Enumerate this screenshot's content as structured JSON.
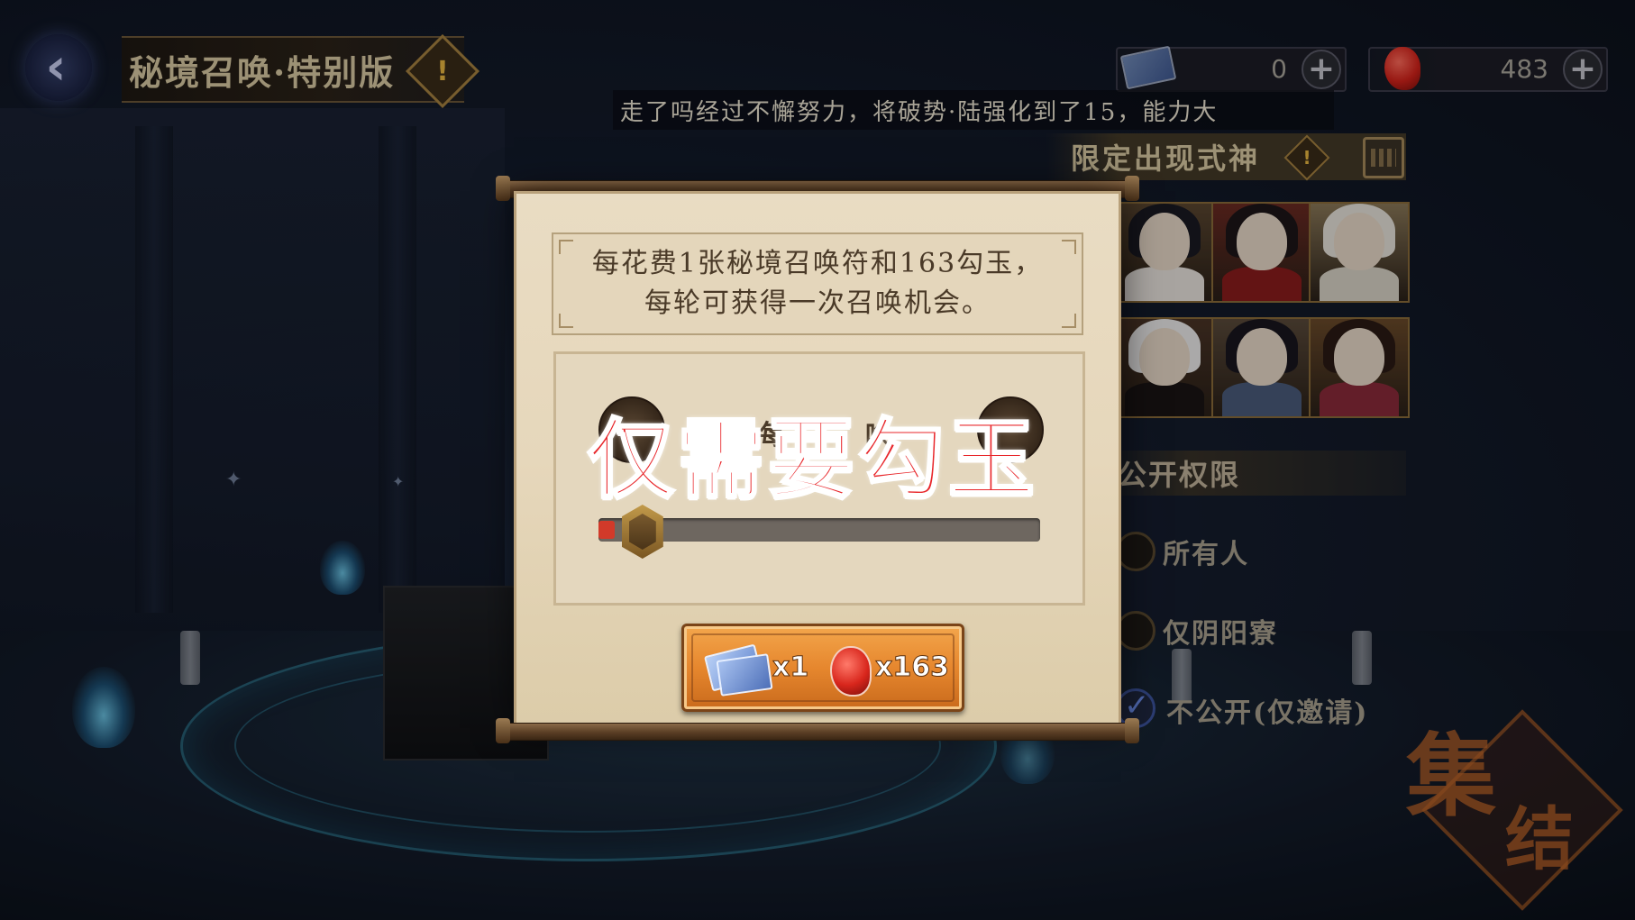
{
  "header": {
    "title": "秘境召唤·特别版",
    "info_icon": "exclamation-icon",
    "back_icon": "chevron-left-icon"
  },
  "resources": {
    "tickets": {
      "icon": "summon-ticket-icon",
      "value": "0",
      "plus": "+"
    },
    "magatama": {
      "icon": "magatama-icon",
      "value": "483",
      "plus": "+"
    }
  },
  "ticker": {
    "text": "走了吗经过不懈努力，将破势·陆强化到了15，能力大"
  },
  "limited": {
    "title": "限定出现式神",
    "info_icon": "exclamation-icon",
    "calendar_icon": "calendar-icon",
    "portraits": [
      {
        "name": "shikigami-portrait-1",
        "hair": "#1a1a22",
        "body": "#e9e4de",
        "bg": "#5a4630"
      },
      {
        "name": "shikigami-portrait-2",
        "hair": "#1c1618",
        "body": "#8a1c1c",
        "bg": "#6a2a22"
      },
      {
        "name": "shikigami-portrait-3",
        "hair": "#e6e2da",
        "body": "#d9d3c6",
        "bg": "#8a7858"
      },
      {
        "name": "shikigami-portrait-4",
        "hair": "#ecebea",
        "body": "#1a1414",
        "bg": "#4a3426"
      },
      {
        "name": "shikigami-portrait-5",
        "hair": "#18161e",
        "body": "#4a5a7a",
        "bg": "#5a4a3a"
      },
      {
        "name": "shikigami-portrait-6",
        "hair": "#2a1a14",
        "body": "#8a2a3a",
        "bg": "#6a4a2a"
      }
    ]
  },
  "permissions": {
    "title": "公开权限",
    "options": [
      {
        "label": "所有人",
        "checked": false
      },
      {
        "label": "仅阴阳寮",
        "checked": false
      },
      {
        "label": "不公开(仅邀请)",
        "checked": true,
        "mark": "✓"
      }
    ]
  },
  "gather_button": {
    "char1": "集",
    "char2": "结"
  },
  "dialog": {
    "desc_line1": "每花费1张秘境召唤符和163勾玉，",
    "desc_line2": "每轮可获得一次召唤机会。",
    "partial_label": "每",
    "partial_label2": "唤",
    "overlay_caption": "仅需要勾玉",
    "slider_value_fraction": 0.02,
    "cost": {
      "ticket_qty": "x1",
      "magatama_qty": "x163"
    }
  },
  "colors": {
    "accent_gold": "#a58240",
    "paper": "#e9dcc3",
    "button_orange": "#e6872e",
    "caption_red": "#e8262a"
  }
}
